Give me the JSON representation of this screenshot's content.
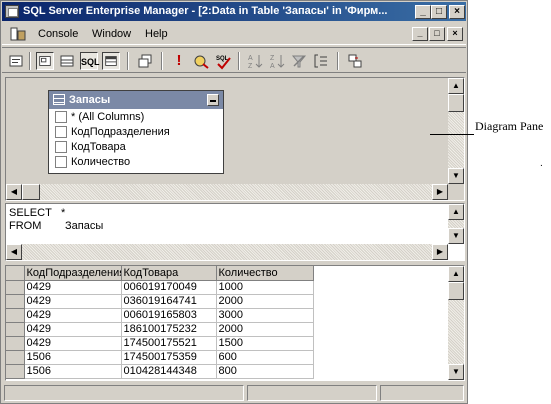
{
  "window": {
    "title": "SQL Server Enterprise Manager - [2:Data in Table 'Запасы' in 'Фирм...",
    "caption_buttons": [
      "_",
      "□",
      "×"
    ]
  },
  "menu": {
    "items": [
      {
        "label": "Console"
      },
      {
        "label": "Window"
      },
      {
        "label": "Help"
      }
    ],
    "mdi_buttons": [
      "_",
      "□",
      "×"
    ]
  },
  "toolbar": {
    "icons": [
      "properties-icon",
      "diagram-pane-icon",
      "grid-pane-icon",
      "sql-pane-icon",
      "results-pane-icon",
      "change-query-type-icon",
      "run-icon",
      "verify-sql-icon",
      "sql-check-icon",
      "sort-ascending-icon",
      "sort-descending-icon",
      "remove-filter-icon",
      "group-by-icon",
      "add-table-icon"
    ],
    "sql_label": "SQL",
    "run_label": "!"
  },
  "diagram": {
    "table_name": "Запасы",
    "columns": [
      "* (All Columns)",
      "КодПодразделения",
      "КодТовара",
      "Количество"
    ]
  },
  "sql": {
    "select_kw": "SELECT",
    "select_val": "*",
    "from_kw": "FROM",
    "from_val": "Запасы"
  },
  "grid": {
    "headers": [
      "КодПодразделения",
      "КодТовара",
      "Количество"
    ],
    "rows": [
      [
        "0429",
        "006019170049",
        "1000"
      ],
      [
        "0429",
        "036019164741",
        "2000"
      ],
      [
        "0429",
        "006019165803",
        "3000"
      ],
      [
        "0429",
        "186100175232",
        "2000"
      ],
      [
        "0429",
        "174500175521",
        "1500"
      ],
      [
        "1506",
        "174500175359",
        "600"
      ],
      [
        "1506",
        "010428144348",
        "800"
      ]
    ]
  },
  "callout": {
    "label": "Diagram Pane",
    "dot": "."
  }
}
